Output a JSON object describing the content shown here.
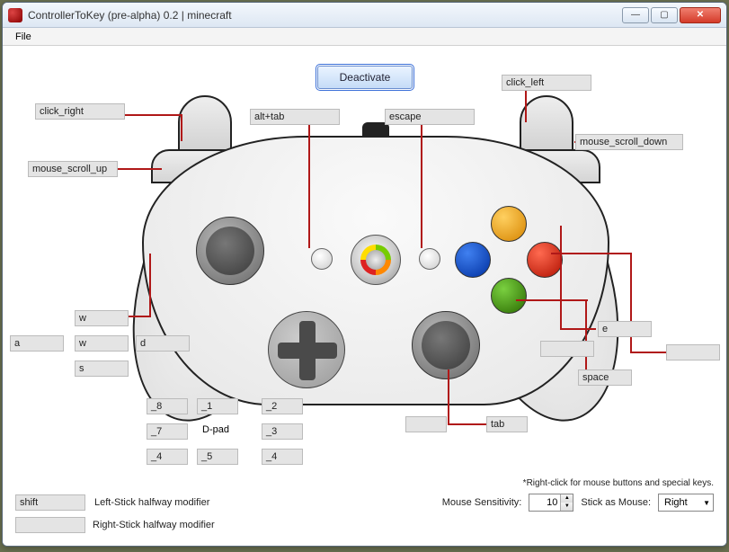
{
  "window": {
    "title": "ControllerToKey (pre-alpha) 0.2 | minecraft"
  },
  "menu": {
    "file": "File"
  },
  "main_button": "Deactivate",
  "bindings": {
    "right_trigger": "click_right",
    "left_trigger": "click_left",
    "back": "alt+tab",
    "start": "escape",
    "right_bumper": "mouse_scroll_down",
    "left_bumper": "mouse_scroll_up",
    "lstick_up": "w",
    "lstick_up2": "w",
    "lstick_left": "a",
    "lstick_right": "d",
    "lstick_down": "s",
    "face_b": "e",
    "face_b_extra": "",
    "face_x": "",
    "face_a": "space",
    "rstick_click": "tab",
    "rstick_side": "",
    "dpad_ul": "_8",
    "dpad_u": "_1",
    "dpad_ur": "_2",
    "dpad_l": "_7",
    "dpad_center_label": "D-pad",
    "dpad_r": "_3",
    "dpad_dl": "_4",
    "dpad_d": "_5",
    "dpad_dr": "_4"
  },
  "modifiers": {
    "left_half": "shift",
    "left_half_label": "Left-Stick halfway modifier",
    "right_half": "",
    "right_half_label": "Right-Stick halfway modifier"
  },
  "footer": {
    "note": "*Right-click for mouse buttons and special keys.",
    "sensitivity_label": "Mouse Sensitivity:",
    "sensitivity_value": "10",
    "stick_label": "Stick as Mouse:",
    "stick_value": "Right"
  }
}
